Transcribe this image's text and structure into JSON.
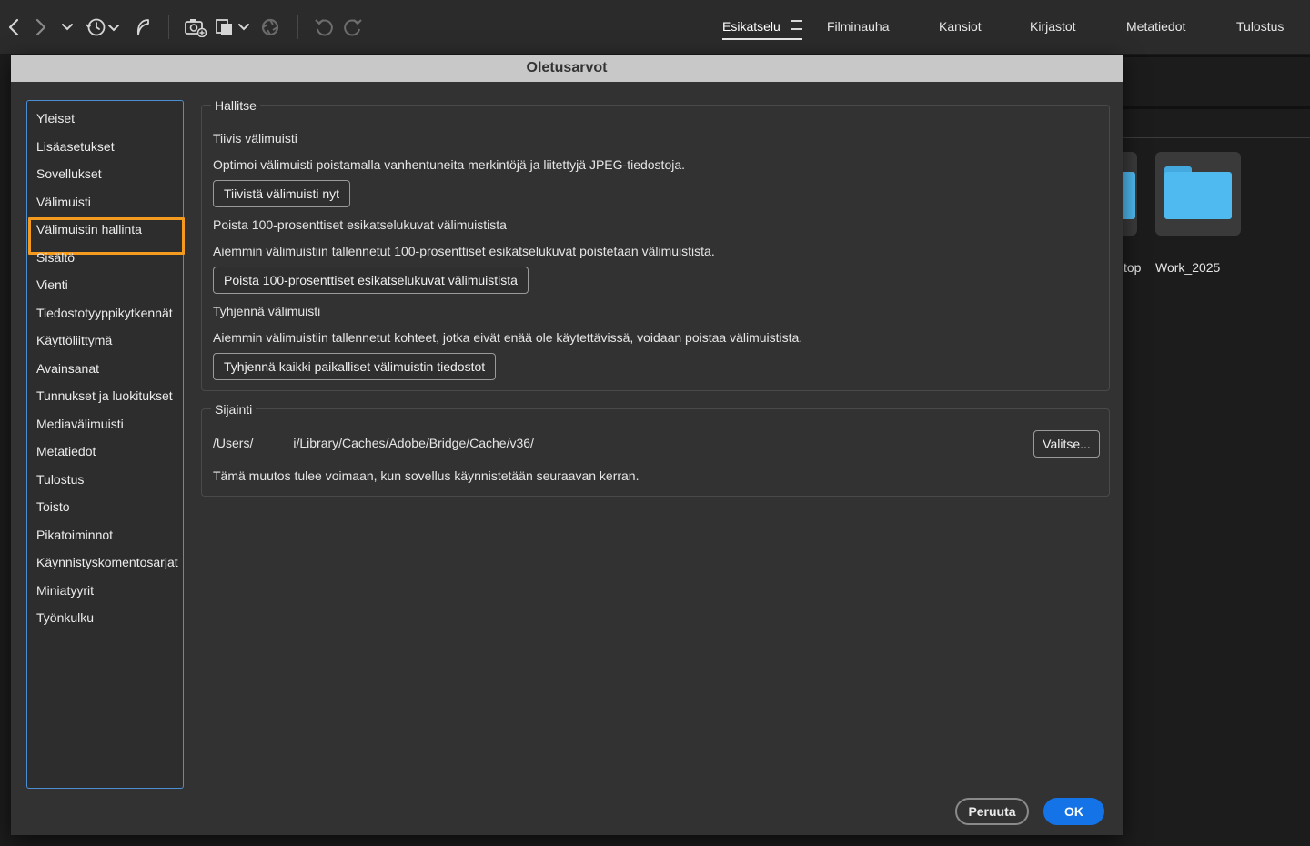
{
  "toolbar": {
    "icons": [
      "back-icon",
      "forward-icon",
      "chevron-down-icon",
      "history-icon",
      "boomerang-icon",
      "camera-import-icon",
      "copy-files-icon",
      "refine-icon",
      "rotate-left-icon",
      "rotate-right-icon"
    ]
  },
  "workspaces": {
    "tabs": [
      "Esikatselu",
      "Filminauha",
      "Kansiot",
      "Kirjastot",
      "Metatiedot",
      "Tulostus"
    ],
    "active": "Esikatselu"
  },
  "background": {
    "items": [
      {
        "label": "top"
      },
      {
        "label": "Work_2025"
      }
    ],
    "folder_color": "#4fbaf0"
  },
  "dialog": {
    "title": "Oletusarvot",
    "categories": [
      "Yleiset",
      "Lisäasetukset",
      "Sovellukset",
      "Välimuisti",
      "Välimuistin hallinta",
      "Sisältö",
      "Vienti",
      "Tiedostotyyppikytkennät",
      "Käyttöliittymä",
      "Avainsanat",
      "Tunnukset ja luokitukset",
      "Mediavälimuisti",
      "Metatiedot",
      "Tulostus",
      "Toisto",
      "Pikatoiminnot",
      "Käynnistyskomentosarjat",
      "Miniatyyrit",
      "Työnkulku"
    ],
    "selected_category": "Välimuistin hallinta",
    "selection_color": "#f39a1f",
    "manage": {
      "legend": "Hallitse",
      "compact_heading": "Tiivis välimuisti",
      "compact_desc": "Optimoi välimuisti poistamalla vanhentuneita merkintöjä ja liitettyjä JPEG-tiedostoja.",
      "compact_button": "Tiivistä välimuisti nyt",
      "purge100_heading": "Poista 100-prosenttiset esikatselukuvat välimuistista",
      "purge100_desc": "Aiemmin välimuistiin tallennetut 100-prosenttiset esikatselukuvat poistetaan välimuistista.",
      "purge100_button": "Poista 100-prosenttiset esikatselukuvat välimuistista",
      "purge_heading": "Tyhjennä välimuisti",
      "purge_desc": "Aiemmin välimuistiin tallennetut kohteet, jotka eivät enää ole käytettävissä, voidaan poistaa välimuistista.",
      "purge_button": "Tyhjennä kaikki paikalliset välimuistin tiedostot"
    },
    "location": {
      "legend": "Sijainti",
      "path_prefix": "/Users/",
      "path_suffix": "i/Library/Caches/Adobe/Bridge/Cache/v36/",
      "choose_button": "Valitse...",
      "note": "Tämä muutos tulee voimaan, kun sovellus käynnistetään seuraavan kerran."
    },
    "cancel_label": "Peruuta",
    "ok_label": "OK",
    "accent": "#1473e6"
  }
}
